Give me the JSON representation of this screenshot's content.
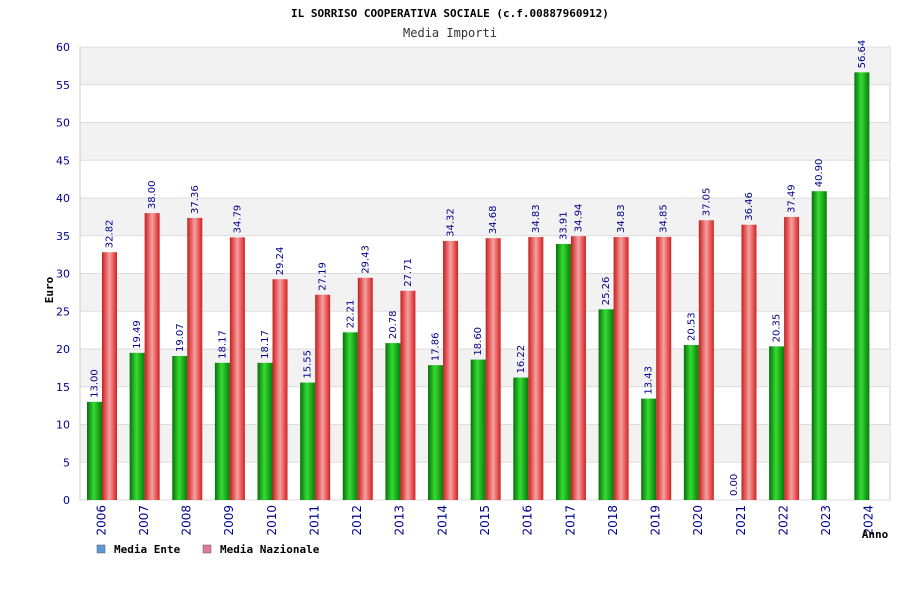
{
  "chart_data": {
    "type": "bar",
    "title": "IL SORRISO COOPERATIVA SOCIALE (c.f.00887960912)",
    "subtitle": "Media Importi",
    "xlabel": "Anno",
    "ylabel": "Euro",
    "ylim": [
      0,
      60
    ],
    "yticks": [
      0,
      5,
      10,
      15,
      20,
      25,
      30,
      35,
      40,
      45,
      50,
      55,
      60
    ],
    "grid": true,
    "legend_position": "bottom-left",
    "categories": [
      "2006",
      "2007",
      "2008",
      "2009",
      "2010",
      "2011",
      "2012",
      "2013",
      "2014",
      "2015",
      "2016",
      "2017",
      "2018",
      "2019",
      "2020",
      "2021",
      "2022",
      "2023",
      "2024"
    ],
    "series": [
      {
        "name": "Media Ente",
        "legend_color": "#5b9bd5",
        "bar_color": "#22aa22",
        "values": [
          13.0,
          19.49,
          19.07,
          18.17,
          18.17,
          15.55,
          22.21,
          20.78,
          17.86,
          18.6,
          16.22,
          33.91,
          25.26,
          13.43,
          20.53,
          0.0,
          20.35,
          40.9,
          56.64
        ],
        "labels": [
          "13.00",
          "19.49",
          "19.07",
          "18.17",
          "18.17",
          "15.55",
          "22.21",
          "20.78",
          "17.86",
          "18.60",
          "16.22",
          "33.91",
          "25.26",
          "13.43",
          "20.53",
          "0.00",
          "20.35",
          "40.90",
          "56.64"
        ]
      },
      {
        "name": "Media Nazionale",
        "legend_color": "#e07aa0",
        "bar_color": "#e83030",
        "values": [
          32.82,
          38.0,
          37.36,
          34.79,
          29.24,
          27.19,
          29.43,
          27.71,
          34.32,
          34.68,
          34.83,
          34.94,
          34.83,
          34.85,
          37.05,
          36.46,
          37.49,
          null,
          null
        ],
        "labels": [
          "32.82",
          "38.00",
          "37.36",
          "34.79",
          "29.24",
          "27.19",
          "29.43",
          "27.71",
          "34.32",
          "34.68",
          "34.83",
          "34.94",
          "34.83",
          "34.85",
          "37.05",
          "36.46",
          "37.49",
          "",
          ""
        ]
      }
    ]
  }
}
